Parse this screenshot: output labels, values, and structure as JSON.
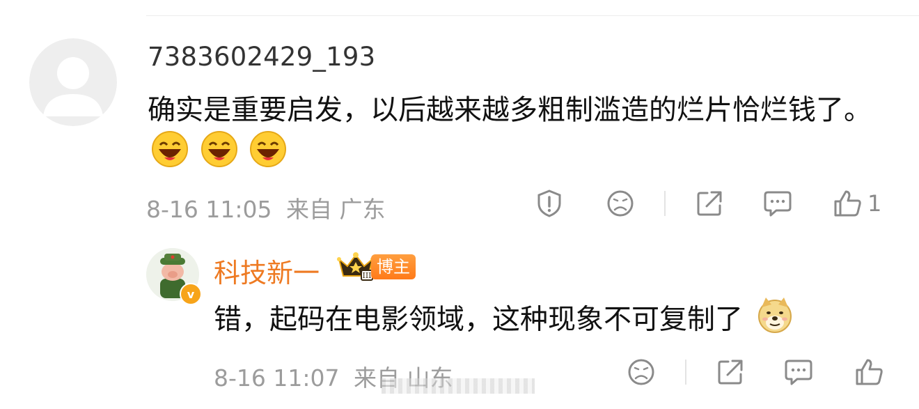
{
  "comment": {
    "username": "7383602429_193",
    "text": "确实是重要启发，以后越来越多粗制滥造的烂片恰烂钱了。",
    "emojis": [
      "laughing-emoji",
      "laughing-emoji",
      "laughing-emoji"
    ],
    "time": "8-16 11:05",
    "location": "来自 广东",
    "like_count": "1"
  },
  "reply": {
    "username": "科技新一",
    "badge": "博主",
    "text": "错，起码在电影领域，这种现象不可复制了",
    "emoji": "doge-emoji",
    "time": "8-16 11:07",
    "location": "来自 山东"
  },
  "colors": {
    "accent": "#ee7a22",
    "meta": "#9c9c9c",
    "icon": "#8a8a8a"
  }
}
